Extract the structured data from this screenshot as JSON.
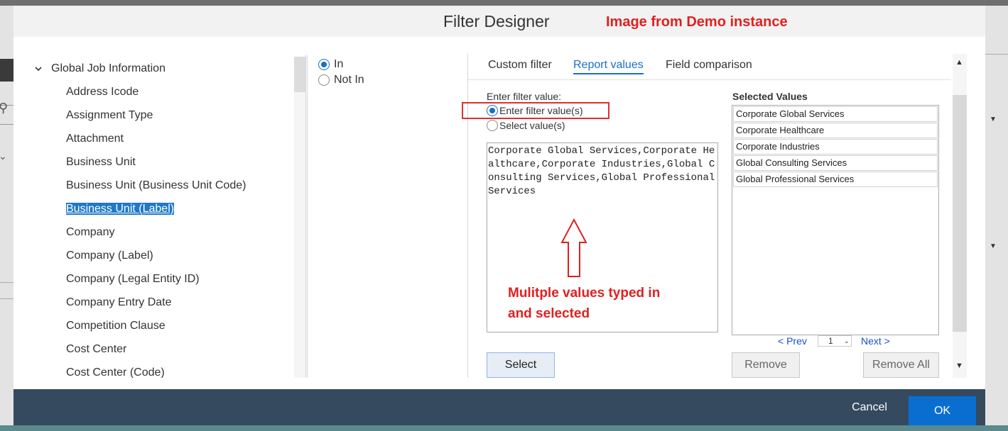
{
  "dialog": {
    "title": "Filter Designer",
    "annotation_top": "Image from Demo instance"
  },
  "tree": {
    "group_label": "Global Job Information",
    "items": [
      "Address Icode",
      "Assignment Type",
      "Attachment",
      "Business Unit",
      "Business Unit (Business Unit Code)",
      "Business Unit (Label)",
      "Company",
      "Company (Label)",
      "Company (Legal Entity ID)",
      "Company Entry Date",
      "Competition Clause",
      "Cost Center",
      "Cost Center (Code)"
    ],
    "selected_index": 5
  },
  "operator": {
    "in_label": "In",
    "not_in_label": "Not In",
    "selected": "In"
  },
  "tabs": {
    "custom_filter": "Custom filter",
    "report_values": "Report values",
    "field_comparison": "Field comparison",
    "active": "Report values"
  },
  "filter_entry": {
    "label": "Enter filter value:",
    "option_enter": "Enter filter value(s)",
    "option_select": "Select value(s)",
    "textarea_value": "Corporate Global Services,Corporate Healthcare,Corporate Industries,Global Consulting Services,Global Professional Services",
    "annotation_line1": "Mulitple values typed in",
    "annotation_line2": "and selected",
    "select_button": "Select"
  },
  "selected_values": {
    "label": "Selected Values",
    "items": [
      "Corporate Global Services",
      "Corporate Healthcare",
      "Corporate Industries",
      "Global Consulting Services",
      "Global Professional Services"
    ],
    "prev_label": "< Prev",
    "next_label": "Next >",
    "page": "1",
    "remove_button": "Remove",
    "remove_all_button": "Remove All"
  },
  "footer": {
    "cancel_label": "Cancel",
    "ok_label": "OK"
  },
  "colors": {
    "accent": "#0a6ed1",
    "annotation_red": "#e02020",
    "footer_bg": "#354a5f"
  }
}
